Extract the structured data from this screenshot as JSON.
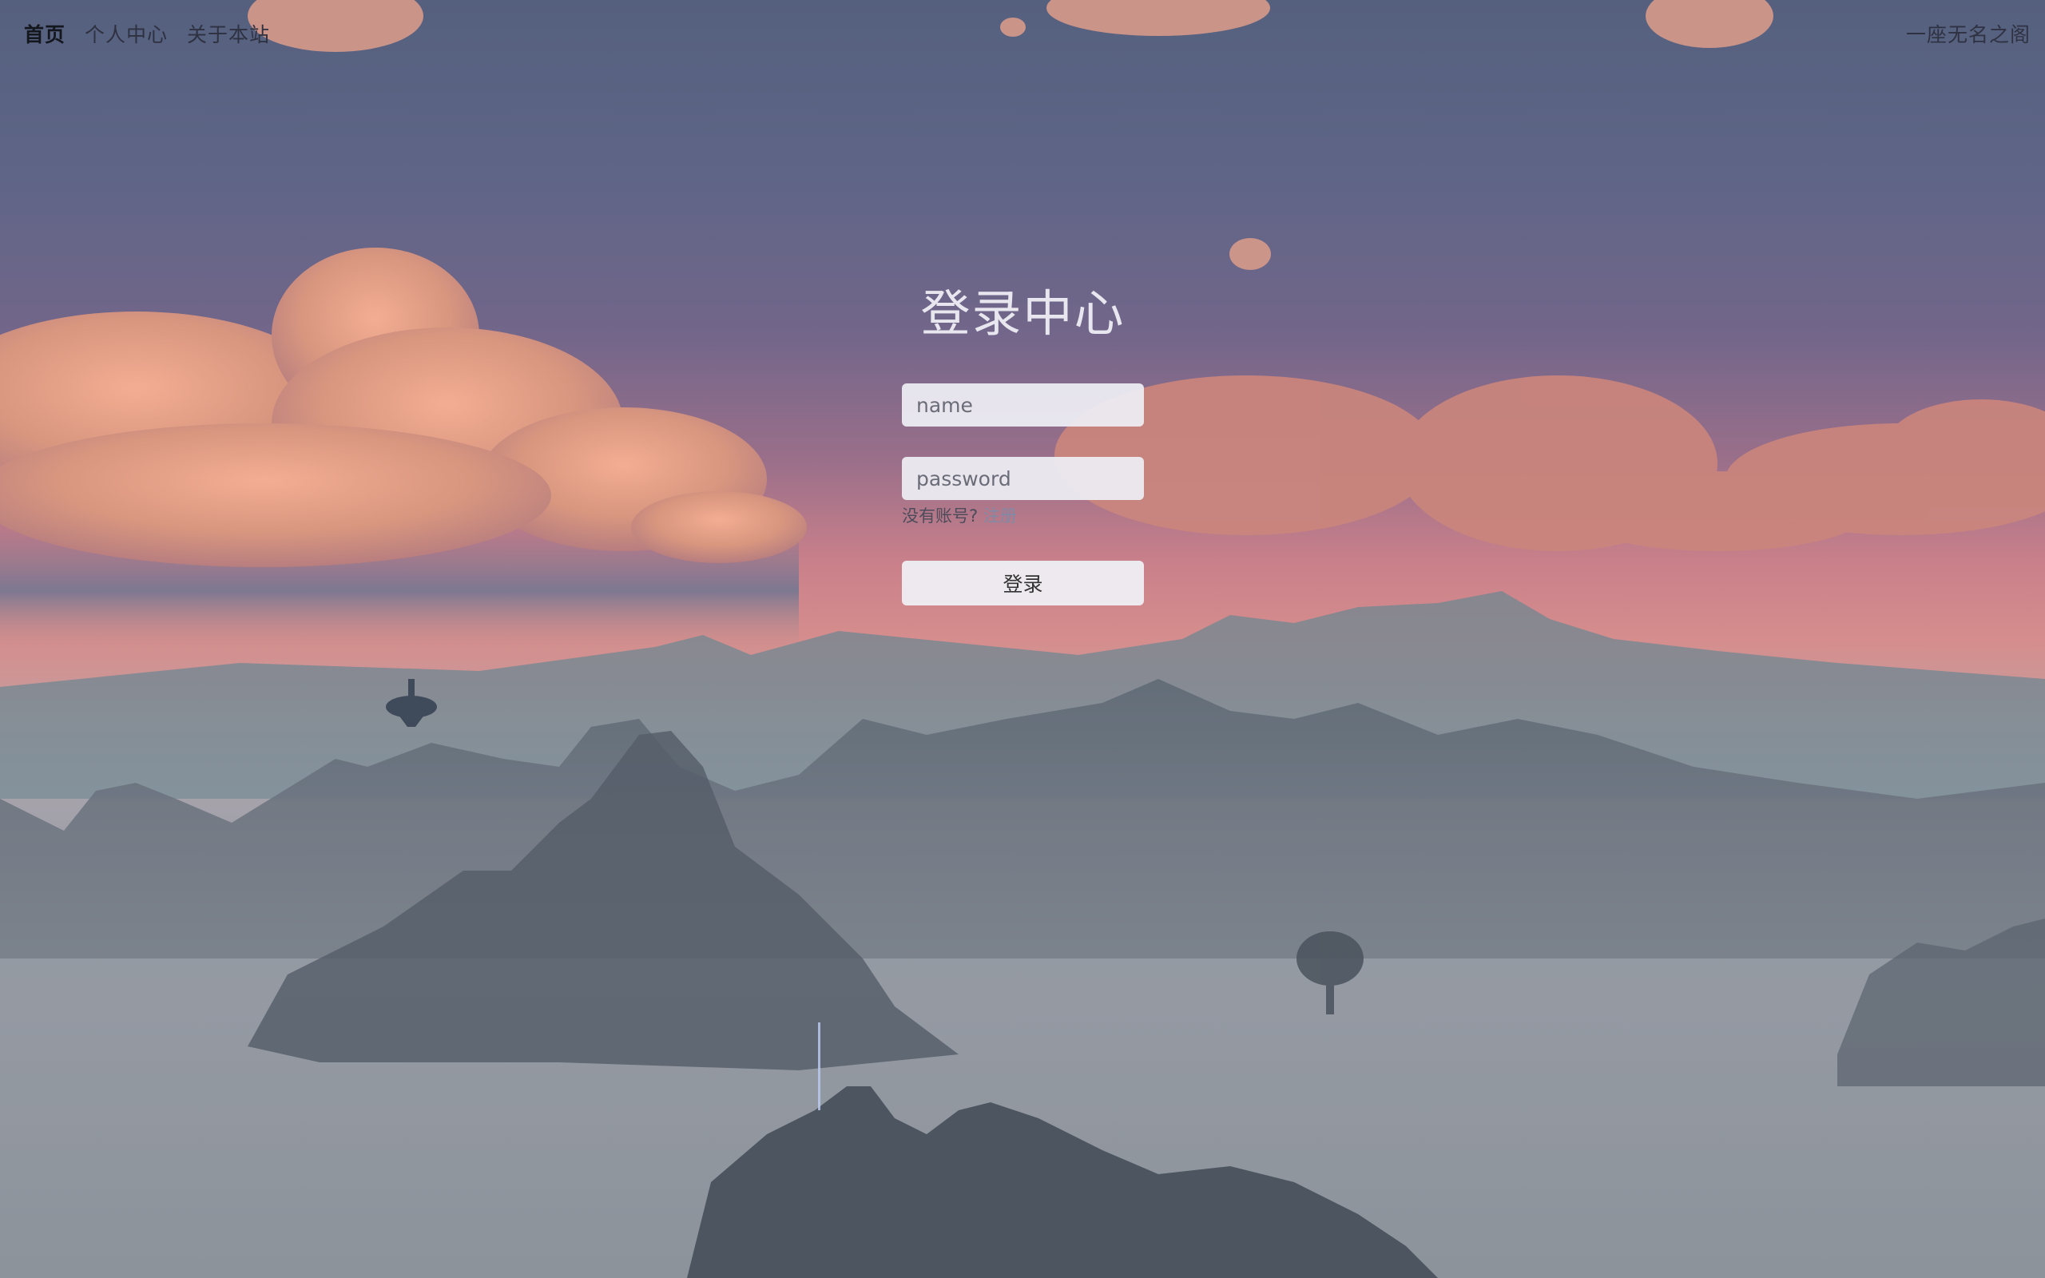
{
  "nav": {
    "items": [
      {
        "label": "首页",
        "active": true
      },
      {
        "label": "个人中心",
        "active": false
      },
      {
        "label": "关于本站",
        "active": false
      }
    ],
    "site_name": "一座无名之阁"
  },
  "login": {
    "title": "登录中心",
    "name_placeholder": "name",
    "password_placeholder": "password",
    "no_account_text": "没有账号?",
    "register_link": "注册",
    "submit_label": "登录"
  },
  "colors": {
    "sky_top": "#55607e",
    "sky_pink": "#d68d8d",
    "mist": "#8f97a1",
    "input_bg": "#eeeef4"
  }
}
